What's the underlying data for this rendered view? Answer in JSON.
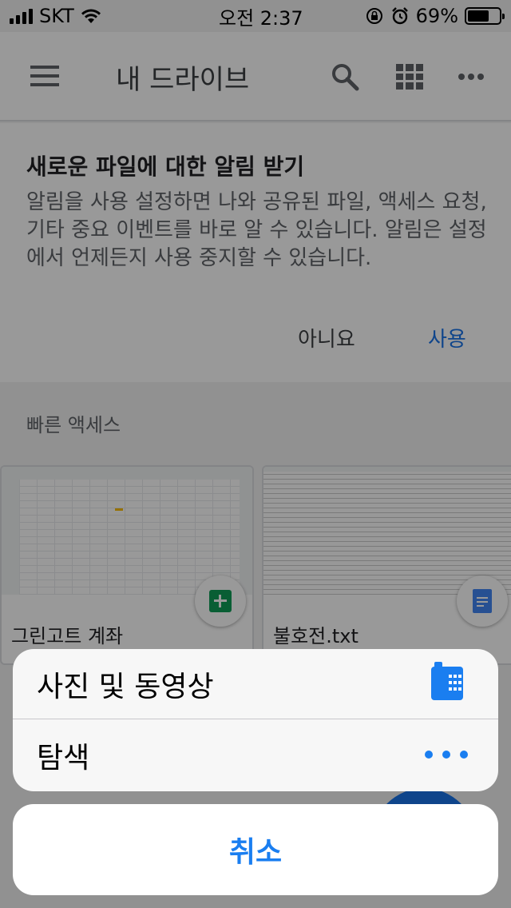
{
  "status_bar": {
    "carrier": "SKT",
    "time": "오전 2:37",
    "battery_percent": "69%",
    "battery_level": 0.69
  },
  "app_bar": {
    "title": "내 드라이브",
    "menu_icon": "hamburger-menu-icon",
    "search_icon": "search-icon",
    "view_icon": "grid-view-icon",
    "more_icon": "more-horizontal-icon"
  },
  "notice": {
    "title": "새로운 파일에 대한 알림 받기",
    "body": "알림을 사용 설정하면 나와 공유된 파일, 액세스 요청, 기타 중요 이벤트를 바로 알 수 있습니다. 알림은 설정에서 언제든지 사용 중지할 수 있습니다.",
    "decline_label": "아니요",
    "accept_label": "사용"
  },
  "quick_access": {
    "label": "빠른 액세스",
    "files": [
      {
        "name": "그린고트 계좌",
        "type_icon": "google-sheets-icon"
      },
      {
        "name": "불호전.txt",
        "type_icon": "google-docs-icon"
      }
    ]
  },
  "action_sheet": {
    "items": [
      {
        "label": "사진 및 동영상",
        "icon": "photo-library-icon"
      },
      {
        "label": "탐색",
        "icon": "more-dots-icon"
      }
    ],
    "cancel_label": "취소"
  },
  "colors": {
    "accent_blue": "#1a73e8",
    "ios_blue": "#1a7ef0",
    "sheets_green": "#0f9d58",
    "docs_blue": "#4285f4"
  }
}
